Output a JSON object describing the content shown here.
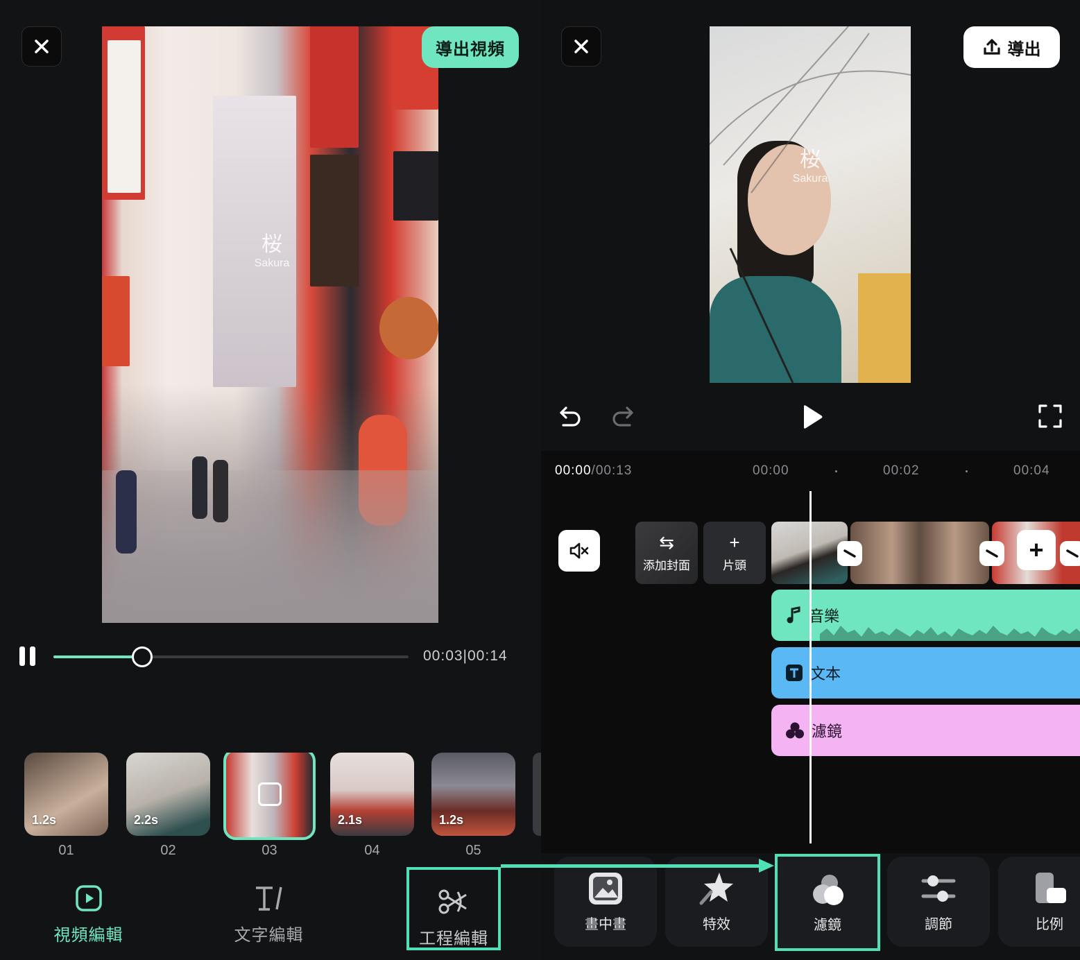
{
  "left": {
    "export_video_label": "導出視頻",
    "watermark": {
      "main": "桜",
      "sub": "Sakura"
    },
    "time_display": "00:03|00:14",
    "progress_fraction": 0.25,
    "clips": [
      {
        "duration": "1.2s",
        "number": "01",
        "selected": false
      },
      {
        "duration": "2.2s",
        "number": "02",
        "selected": false
      },
      {
        "duration": "",
        "number": "03",
        "selected": true
      },
      {
        "duration": "2.1s",
        "number": "04",
        "selected": false
      },
      {
        "duration": "1.2s",
        "number": "05",
        "selected": false
      }
    ],
    "tabs": [
      {
        "label": "視頻編輯",
        "icon": "play-square-icon",
        "active": true
      },
      {
        "label": "文字編輯",
        "icon": "text-cursor-icon",
        "active": false
      },
      {
        "label": "工程編輯",
        "icon": "scissors-icon",
        "active": false,
        "highlighted": true
      }
    ]
  },
  "right": {
    "export_label": "導出",
    "watermark": {
      "main": "桜",
      "sub": "Sakura"
    },
    "timeline": {
      "current": "00:00",
      "total": "/00:13",
      "ticks": [
        "00:00",
        "00:02",
        "00:04"
      ]
    },
    "tiles": {
      "cover": "添加封面",
      "head": "片頭"
    },
    "tracks": {
      "music": "音樂",
      "text": "文本",
      "filter": "濾鏡"
    },
    "tools": [
      {
        "label": "畫中畫",
        "icon": "picture-in-picture-icon"
      },
      {
        "label": "特效",
        "icon": "star-effect-icon"
      },
      {
        "label": "濾鏡",
        "icon": "filter-circles-icon",
        "highlighted": true
      },
      {
        "label": "調節",
        "icon": "sliders-icon"
      },
      {
        "label": "比例",
        "icon": "aspect-ratio-icon"
      }
    ]
  },
  "colors": {
    "accent": "#6fe6bf",
    "highlight_box": "#4fe0b8",
    "text_track": "#5ab8f5",
    "filter_track": "#f4b3f3"
  }
}
